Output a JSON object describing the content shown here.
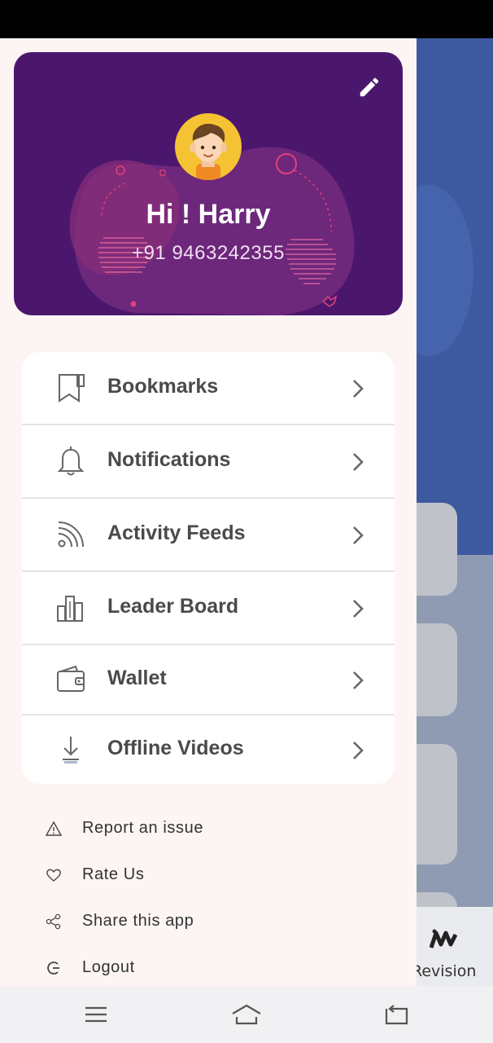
{
  "profile": {
    "greeting": "Hi ! Harry",
    "phone": "+91 9463242355",
    "avatar_icon": "boy-avatar-icon",
    "edit_icon": "pencil-icon",
    "card_color": "#4b176d",
    "accent_color": "#e0407a"
  },
  "menu": [
    {
      "label": "Bookmarks",
      "icon": "bookmark-icon"
    },
    {
      "label": "Notifications",
      "icon": "bell-icon"
    },
    {
      "label": "Activity Feeds",
      "icon": "rss-icon"
    },
    {
      "label": "Leader Board",
      "icon": "bar-chart-icon"
    },
    {
      "label": "Wallet",
      "icon": "wallet-icon"
    },
    {
      "label": "Offline Videos",
      "icon": "download-icon"
    }
  ],
  "links": [
    {
      "label": "Report an issue",
      "icon": "warning-icon"
    },
    {
      "label": "Rate Us",
      "icon": "heart-icon"
    },
    {
      "label": "Share this app",
      "icon": "share-icon"
    },
    {
      "label": "Logout",
      "icon": "logout-icon"
    }
  ],
  "background_app": {
    "nav_label": "Revision"
  },
  "system_nav": [
    "menu-icon",
    "home-icon",
    "back-icon"
  ]
}
